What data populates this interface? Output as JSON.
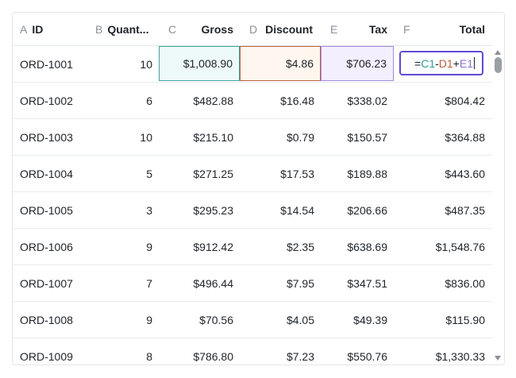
{
  "columns": [
    {
      "letter": "A",
      "name": "ID"
    },
    {
      "letter": "B",
      "name": "Quant..."
    },
    {
      "letter": "C",
      "name": "Gross"
    },
    {
      "letter": "D",
      "name": "Discount"
    },
    {
      "letter": "E",
      "name": "Tax"
    },
    {
      "letter": "F",
      "name": "Total"
    }
  ],
  "rows": [
    {
      "id": "ORD-1001",
      "qty": "10",
      "gross": "$1,008.90",
      "discount": "$4.86",
      "tax": "$706.23",
      "total": ""
    },
    {
      "id": "ORD-1002",
      "qty": "6",
      "gross": "$482.88",
      "discount": "$16.48",
      "tax": "$338.02",
      "total": "$804.42"
    },
    {
      "id": "ORD-1003",
      "qty": "10",
      "gross": "$215.10",
      "discount": "$0.79",
      "tax": "$150.57",
      "total": "$364.88"
    },
    {
      "id": "ORD-1004",
      "qty": "5",
      "gross": "$271.25",
      "discount": "$17.53",
      "tax": "$189.88",
      "total": "$443.60"
    },
    {
      "id": "ORD-1005",
      "qty": "3",
      "gross": "$295.23",
      "discount": "$14.54",
      "tax": "$206.66",
      "total": "$487.35"
    },
    {
      "id": "ORD-1006",
      "qty": "9",
      "gross": "$912.42",
      "discount": "$2.35",
      "tax": "$638.69",
      "total": "$1,548.76"
    },
    {
      "id": "ORD-1007",
      "qty": "7",
      "gross": "$496.44",
      "discount": "$7.95",
      "tax": "$347.51",
      "total": "$836.00"
    },
    {
      "id": "ORD-1008",
      "qty": "9",
      "gross": "$70.56",
      "discount": "$4.05",
      "tax": "$49.39",
      "total": "$115.90"
    },
    {
      "id": "ORD-1009",
      "qty": "8",
      "gross": "$786.80",
      "discount": "$7.23",
      "tax": "$550.76",
      "total": "$1,330.33"
    }
  ],
  "editor": {
    "tokens": [
      {
        "text": "=",
        "kind": "op"
      },
      {
        "text": "C1",
        "kind": "c"
      },
      {
        "text": "-",
        "kind": "op"
      },
      {
        "text": "D1",
        "kind": "d"
      },
      {
        "text": "+",
        "kind": "op"
      },
      {
        "text": "E1",
        "kind": "e"
      }
    ]
  },
  "colors": {
    "ref_c": "#3ea79f",
    "ref_d": "#b9603c",
    "ref_e": "#a48be0",
    "editor_border": "#5f4bd1"
  },
  "icons": {
    "scroll_up": "triangle-up-icon",
    "scroll_down": "triangle-down-icon"
  }
}
